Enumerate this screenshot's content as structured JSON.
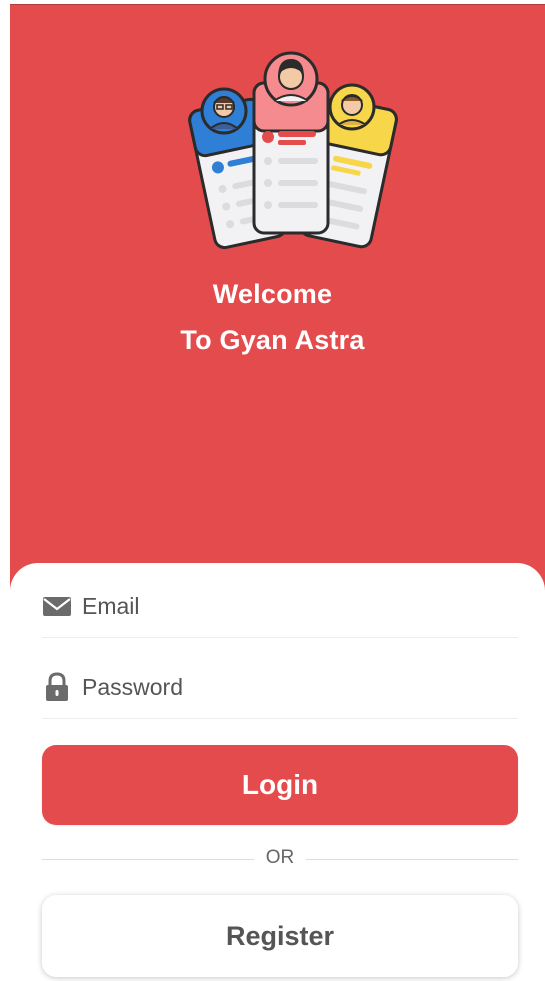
{
  "header": {
    "welcome_line1": "Welcome",
    "welcome_line2": "To Gyan Astra"
  },
  "form": {
    "email": {
      "placeholder": "Email",
      "value": "",
      "icon": "envelope-icon"
    },
    "password": {
      "placeholder": "Password",
      "value": "",
      "icon": "lock-icon"
    },
    "login_label": "Login",
    "divider_label": "OR",
    "register_label": "Register"
  },
  "colors": {
    "brand_red": "#e34b4c",
    "card_blue": "#2f7fd6",
    "card_pink": "#f58b8e",
    "card_yellow": "#f7d64a"
  }
}
